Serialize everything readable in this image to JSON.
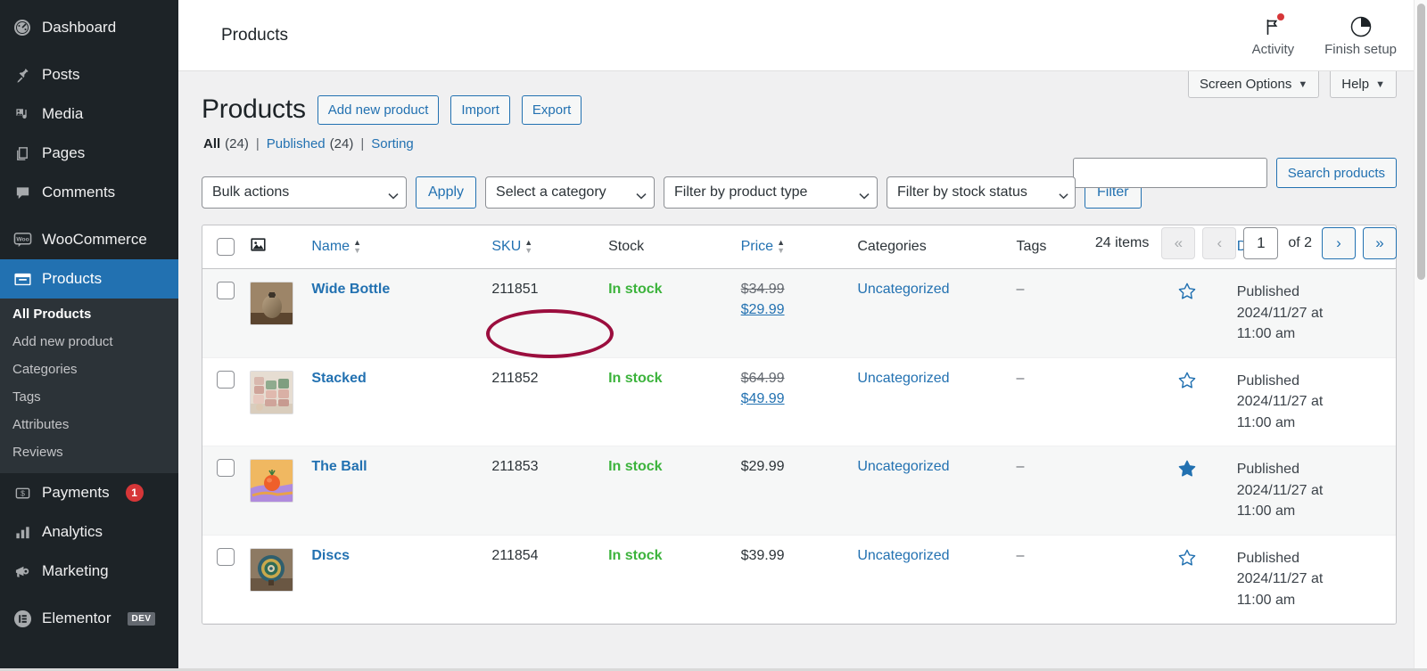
{
  "sidebar": {
    "items": [
      {
        "label": "Dashboard",
        "icon": "dashboard-icon",
        "current": false
      },
      {
        "label": "Posts",
        "icon": "pin-icon",
        "current": false
      },
      {
        "label": "Media",
        "icon": "media-icon",
        "current": false
      },
      {
        "label": "Pages",
        "icon": "pages-icon",
        "current": false
      },
      {
        "label": "Comments",
        "icon": "comments-icon",
        "current": false
      },
      {
        "label": "WooCommerce",
        "icon": "woocommerce-icon",
        "current": false
      },
      {
        "label": "Products",
        "icon": "products-icon",
        "current": true
      },
      {
        "label": "Payments",
        "icon": "payments-icon",
        "current": false,
        "badge": "1"
      },
      {
        "label": "Analytics",
        "icon": "analytics-icon",
        "current": false
      },
      {
        "label": "Marketing",
        "icon": "marketing-icon",
        "current": false
      },
      {
        "label": "Elementor",
        "icon": "elementor-icon",
        "current": false,
        "badge_text": "DEV"
      }
    ],
    "submenu": [
      {
        "label": "All Products",
        "active": true
      },
      {
        "label": "Add new product",
        "active": false
      },
      {
        "label": "Categories",
        "active": false
      },
      {
        "label": "Tags",
        "active": false
      },
      {
        "label": "Attributes",
        "active": false
      },
      {
        "label": "Reviews",
        "active": false
      }
    ]
  },
  "topbar": {
    "breadcrumb": "Products",
    "activity_label": "Activity",
    "finish_setup_label": "Finish setup"
  },
  "screen_meta": {
    "screen_options_label": "Screen Options",
    "help_label": "Help",
    "caret": "▼"
  },
  "page": {
    "title": "Products",
    "add_new_label": "Add new product",
    "import_label": "Import",
    "export_label": "Export"
  },
  "views": {
    "all_label": "All",
    "all_count": "(24)",
    "published_label": "Published",
    "published_count": "(24)",
    "sorting_label": "Sorting",
    "separator": "|"
  },
  "search": {
    "value": "",
    "placeholder": "",
    "button_label": "Search products"
  },
  "filters": {
    "bulk_actions_label": "Bulk actions",
    "apply_label": "Apply",
    "category_label": "Select a category",
    "product_type_label": "Filter by product type",
    "stock_status_label": "Filter by stock status",
    "filter_label": "Filter"
  },
  "pagination": {
    "items_text": "24 items",
    "first_label": "«",
    "prev_label": "‹",
    "current_page": "1",
    "of_text": "of 2",
    "next_label": "›",
    "last_label": "»"
  },
  "table": {
    "columns": {
      "image": "image-icon",
      "name": "Name",
      "sku": "SKU",
      "stock": "Stock",
      "price": "Price",
      "categories": "Categories",
      "tags": "Tags",
      "featured": "★",
      "date": "Date"
    },
    "rows": [
      {
        "name": "Wide Bottle",
        "sku": "211851",
        "stock": "In stock",
        "price_regular": "$34.99",
        "price_sale": "$29.99",
        "categories": "Uncategorized",
        "tags": "–",
        "featured": false,
        "date_status": "Published",
        "date_value": "2024/11/27 at",
        "date_time": "11:00 am",
        "thumb": "vase-photo"
      },
      {
        "name": "Stacked",
        "sku": "211852",
        "stock": "In stock",
        "price_regular": "$64.99",
        "price_sale": "$49.99",
        "categories": "Uncategorized",
        "tags": "–",
        "featured": false,
        "date_status": "Published",
        "date_value": "2024/11/27 at",
        "date_time": "11:00 am",
        "thumb": "stacked-pots-photo"
      },
      {
        "name": "The Ball",
        "sku": "211853",
        "stock": "In stock",
        "price_regular": "",
        "price_sale": "",
        "price_plain": "$29.99",
        "categories": "Uncategorized",
        "tags": "–",
        "featured": true,
        "date_status": "Published",
        "date_value": "2024/11/27 at",
        "date_time": "11:00 am",
        "thumb": "orange-ball-photo"
      },
      {
        "name": "Discs",
        "sku": "211854",
        "stock": "In stock",
        "price_regular": "",
        "price_sale": "",
        "price_plain": "$39.99",
        "categories": "Uncategorized",
        "tags": "–",
        "featured": false,
        "date_status": "Published",
        "date_value": "2024/11/27 at",
        "date_time": "11:00 am",
        "thumb": "decorative-plate-photo"
      }
    ]
  },
  "annotation": {
    "shape": "ellipse",
    "color": "#9b0e3e",
    "targets": "Wide Bottle"
  },
  "colors": {
    "sidebar_bg": "#1d2327",
    "accent_blue": "#2271b1",
    "in_stock_green": "#3cb33c",
    "badge_red": "#d63638",
    "annotation": "#9b0e3e"
  }
}
